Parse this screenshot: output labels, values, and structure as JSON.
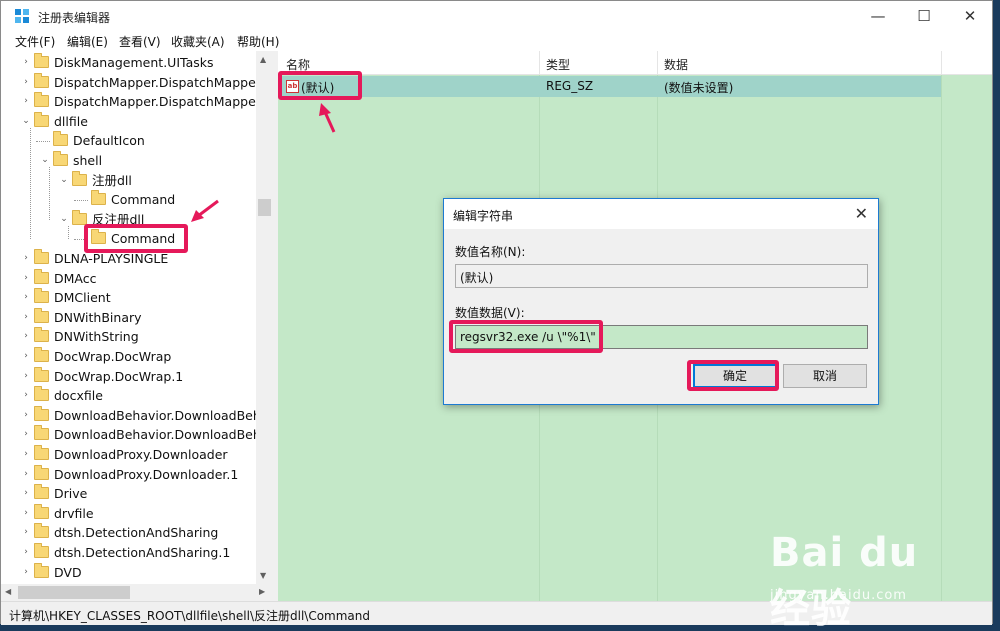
{
  "window": {
    "title": "注册表编辑器",
    "controls": {
      "minimize": "—",
      "maximize": "☐",
      "close": "✕"
    }
  },
  "menu": [
    "文件(F)",
    "编辑(E)",
    "查看(V)",
    "收藏夹(A)",
    "帮助(H)"
  ],
  "tree": {
    "items": [
      {
        "label": "DiskManagement.UITasks",
        "depth": 1,
        "chevron": "›"
      },
      {
        "label": "DispatchMapper.DispatchMapper",
        "depth": 1,
        "chevron": "›"
      },
      {
        "label": "DispatchMapper.DispatchMapper.",
        "depth": 1,
        "chevron": "›"
      },
      {
        "label": "dllfile",
        "depth": 1,
        "chevron": "⌄"
      },
      {
        "label": "DefaultIcon",
        "depth": 2,
        "chevron": ""
      },
      {
        "label": "shell",
        "depth": 2,
        "chevron": "⌄"
      },
      {
        "label": "注册dll",
        "depth": 3,
        "chevron": "⌄"
      },
      {
        "label": "Command",
        "depth": 4,
        "chevron": ""
      },
      {
        "label": "反注册dll",
        "depth": 3,
        "chevron": "⌄"
      },
      {
        "label": "Command",
        "depth": 4,
        "chevron": ""
      },
      {
        "label": "DLNA-PLAYSINGLE",
        "depth": 1,
        "chevron": "›"
      },
      {
        "label": "DMAcc",
        "depth": 1,
        "chevron": "›"
      },
      {
        "label": "DMClient",
        "depth": 1,
        "chevron": "›"
      },
      {
        "label": "DNWithBinary",
        "depth": 1,
        "chevron": "›"
      },
      {
        "label": "DNWithString",
        "depth": 1,
        "chevron": "›"
      },
      {
        "label": "DocWrap.DocWrap",
        "depth": 1,
        "chevron": "›"
      },
      {
        "label": "DocWrap.DocWrap.1",
        "depth": 1,
        "chevron": "›"
      },
      {
        "label": "docxfile",
        "depth": 1,
        "chevron": "›"
      },
      {
        "label": "DownloadBehavior.DownloadBeha",
        "depth": 1,
        "chevron": "›"
      },
      {
        "label": "DownloadBehavior.DownloadBeha",
        "depth": 1,
        "chevron": "›"
      },
      {
        "label": "DownloadProxy.Downloader",
        "depth": 1,
        "chevron": "›"
      },
      {
        "label": "DownloadProxy.Downloader.1",
        "depth": 1,
        "chevron": "›"
      },
      {
        "label": "Drive",
        "depth": 1,
        "chevron": "›"
      },
      {
        "label": "drvfile",
        "depth": 1,
        "chevron": "›"
      },
      {
        "label": "dtsh.DetectionAndSharing",
        "depth": 1,
        "chevron": "›"
      },
      {
        "label": "dtsh.DetectionAndSharing.1",
        "depth": 1,
        "chevron": "›"
      },
      {
        "label": "DVD",
        "depth": 1,
        "chevron": "›"
      }
    ]
  },
  "list": {
    "columns": [
      "名称",
      "类型",
      "数据"
    ],
    "rows": [
      {
        "name": "(默认)",
        "type": "REG_SZ",
        "data": "(数值未设置)",
        "icon": "ab"
      }
    ]
  },
  "status": {
    "path": "计算机\\HKEY_CLASSES_ROOT\\dllfile\\shell\\反注册dll\\Command"
  },
  "dialog": {
    "title": "编辑字符串",
    "name_label": "数值名称(N):",
    "name_value": "(默认)",
    "data_label": "数值数据(V):",
    "data_value": "regsvr32.exe /u \\\"%1\\\"",
    "ok": "确定",
    "cancel": "取消",
    "close": "✕"
  },
  "watermark": {
    "logo": "Bai du 经验",
    "url": "jingyan.baidu.com"
  },
  "colors": {
    "highlight": "#e5195a",
    "list_bg": "#c4e8c8",
    "selection": "#9fd3c9"
  }
}
